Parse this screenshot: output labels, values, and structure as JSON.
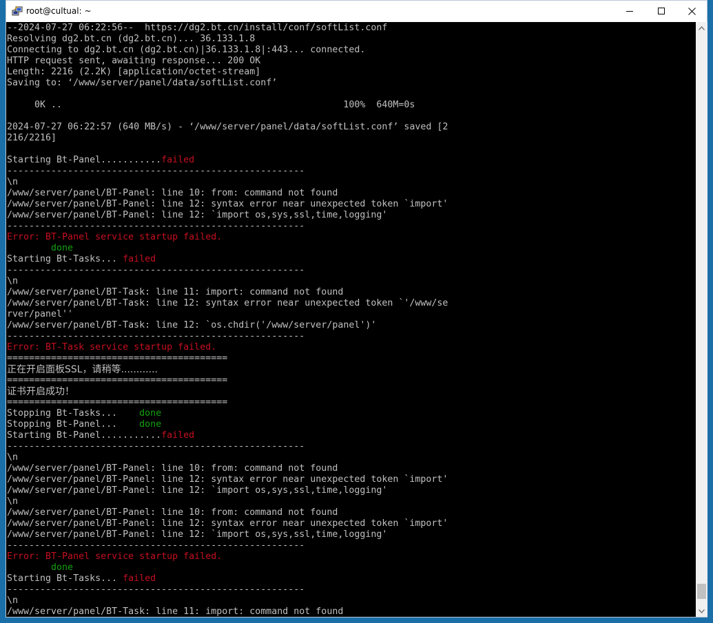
{
  "window": {
    "title": "root@cultual: ~"
  },
  "colors": {
    "terminal_bg": "#000000",
    "text_default": "#c0c0c0",
    "text_red": "#c50f1f",
    "text_green": "#13a10e"
  },
  "icons": {
    "app": "putty-icon",
    "minimize": "minimize-icon",
    "maximize": "maximize-icon",
    "close": "close-icon"
  },
  "terminal": {
    "lines": [
      [
        {
          "t": "--2024-07-27 06:22:56--  https://dg2.bt.cn/install/conf/softList.conf",
          "c": "default"
        }
      ],
      [
        {
          "t": "Resolving dg2.bt.cn (dg2.bt.cn)... 36.133.1.8",
          "c": "default"
        }
      ],
      [
        {
          "t": "Connecting to dg2.bt.cn (dg2.bt.cn)|36.133.1.8|:443... connected.",
          "c": "default"
        }
      ],
      [
        {
          "t": "HTTP request sent, awaiting response... 200 OK",
          "c": "default"
        }
      ],
      [
        {
          "t": "Length: 2216 (2.2K) [application/octet-stream]",
          "c": "default"
        }
      ],
      [
        {
          "t": "Saving to: ‘/www/server/panel/data/softList.conf’",
          "c": "default"
        }
      ],
      [
        {
          "t": "",
          "c": "default"
        }
      ],
      [
        {
          "t": "     0K ..                                                   100%  640M=0s",
          "c": "default"
        }
      ],
      [
        {
          "t": "",
          "c": "default"
        }
      ],
      [
        {
          "t": "2024-07-27 06:22:57 (640 MB/s) - ‘/www/server/panel/data/softList.conf’ saved [2",
          "c": "default"
        }
      ],
      [
        {
          "t": "216/2216]",
          "c": "default"
        }
      ],
      [
        {
          "t": "",
          "c": "default"
        }
      ],
      [
        {
          "t": "Starting Bt-Panel...........",
          "c": "default"
        },
        {
          "t": "failed",
          "c": "red"
        }
      ],
      [
        {
          "t": "------------------------------------------------------",
          "c": "default"
        }
      ],
      [
        {
          "t": "\\n",
          "c": "default"
        }
      ],
      [
        {
          "t": "/www/server/panel/BT-Panel: line 10: from: command not found",
          "c": "default"
        }
      ],
      [
        {
          "t": "/www/server/panel/BT-Panel: line 12: syntax error near unexpected token `import'",
          "c": "default"
        }
      ],
      [
        {
          "t": "/www/server/panel/BT-Panel: line 12: `import os,sys,ssl,time,logging'",
          "c": "default"
        }
      ],
      [
        {
          "t": "------------------------------------------------------",
          "c": "default"
        }
      ],
      [
        {
          "t": "Error: BT-Panel service startup failed.",
          "c": "red"
        }
      ],
      [
        {
          "t": "        done",
          "c": "green"
        }
      ],
      [
        {
          "t": "Starting Bt-Tasks... ",
          "c": "default"
        },
        {
          "t": "failed",
          "c": "red"
        }
      ],
      [
        {
          "t": "------------------------------------------------------",
          "c": "default"
        }
      ],
      [
        {
          "t": "\\n",
          "c": "default"
        }
      ],
      [
        {
          "t": "/www/server/panel/BT-Task: line 11: import: command not found",
          "c": "default"
        }
      ],
      [
        {
          "t": "/www/server/panel/BT-Task: line 12: syntax error near unexpected token `'/www/se",
          "c": "default"
        }
      ],
      [
        {
          "t": "rver/panel''",
          "c": "default"
        }
      ],
      [
        {
          "t": "/www/server/panel/BT-Task: line 12: `os.chdir('/www/server/panel')'",
          "c": "default"
        }
      ],
      [
        {
          "t": "------------------------------------------------------",
          "c": "default"
        }
      ],
      [
        {
          "t": "Error: BT-Task service startup failed.",
          "c": "red"
        }
      ],
      [
        {
          "t": "========================================",
          "c": "default"
        }
      ],
      [
        {
          "t": "正在开启面板SSL，请稍等............",
          "c": "default",
          "cjk": true
        }
      ],
      [
        {
          "t": "========================================",
          "c": "default"
        }
      ],
      [
        {
          "t": "证书开启成功！",
          "c": "default",
          "cjk": true
        }
      ],
      [
        {
          "t": "========================================",
          "c": "default"
        }
      ],
      [
        {
          "t": "Stopping Bt-Tasks...    ",
          "c": "default"
        },
        {
          "t": "done",
          "c": "green"
        }
      ],
      [
        {
          "t": "Stopping Bt-Panel...    ",
          "c": "default"
        },
        {
          "t": "done",
          "c": "green"
        }
      ],
      [
        {
          "t": "Starting Bt-Panel...........",
          "c": "default"
        },
        {
          "t": "failed",
          "c": "red"
        }
      ],
      [
        {
          "t": "------------------------------------------------------",
          "c": "default"
        }
      ],
      [
        {
          "t": "\\n",
          "c": "default"
        }
      ],
      [
        {
          "t": "/www/server/panel/BT-Panel: line 10: from: command not found",
          "c": "default"
        }
      ],
      [
        {
          "t": "/www/server/panel/BT-Panel: line 12: syntax error near unexpected token `import'",
          "c": "default"
        }
      ],
      [
        {
          "t": "/www/server/panel/BT-Panel: line 12: `import os,sys,ssl,time,logging'",
          "c": "default"
        }
      ],
      [
        {
          "t": "\\n",
          "c": "default"
        }
      ],
      [
        {
          "t": "/www/server/panel/BT-Panel: line 10: from: command not found",
          "c": "default"
        }
      ],
      [
        {
          "t": "/www/server/panel/BT-Panel: line 12: syntax error near unexpected token `import'",
          "c": "default"
        }
      ],
      [
        {
          "t": "/www/server/panel/BT-Panel: line 12: `import os,sys,ssl,time,logging'",
          "c": "default"
        }
      ],
      [
        {
          "t": "------------------------------------------------------",
          "c": "default"
        }
      ],
      [
        {
          "t": "Error: BT-Panel service startup failed.",
          "c": "red"
        }
      ],
      [
        {
          "t": "        done",
          "c": "green"
        }
      ],
      [
        {
          "t": "Starting Bt-Tasks... ",
          "c": "default"
        },
        {
          "t": "failed",
          "c": "red"
        }
      ],
      [
        {
          "t": "------------------------------------------------------",
          "c": "default"
        }
      ],
      [
        {
          "t": "\\n",
          "c": "default"
        }
      ],
      [
        {
          "t": "/www/server/panel/BT-Task: line 11: import: command not found",
          "c": "default"
        }
      ]
    ]
  }
}
